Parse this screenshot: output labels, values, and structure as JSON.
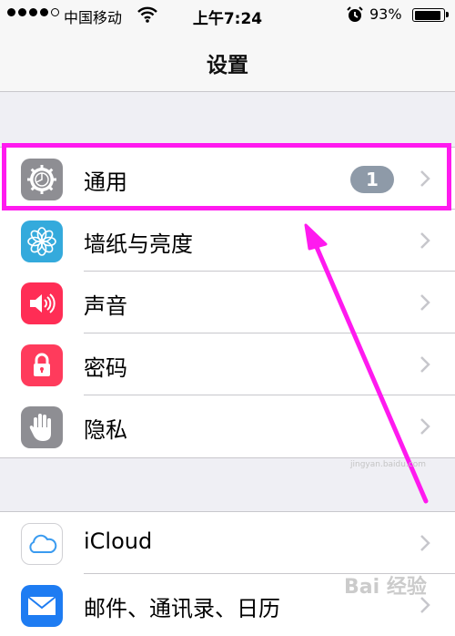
{
  "status_bar": {
    "signal_bars_filled": 4,
    "signal_bars_total": 5,
    "carrier": "中国移动",
    "time": "上午7:24",
    "battery_percent": "93%",
    "battery_level": 0.93
  },
  "nav": {
    "title": "设置"
  },
  "group1": {
    "items": [
      {
        "label": "通用",
        "icon": "gear-icon",
        "badge": "1"
      },
      {
        "label": "墙纸与亮度",
        "icon": "flower-icon"
      },
      {
        "label": "声音",
        "icon": "speaker-icon"
      },
      {
        "label": "密码",
        "icon": "lock-icon"
      },
      {
        "label": "隐私",
        "icon": "hand-icon"
      }
    ]
  },
  "group2": {
    "items": [
      {
        "label": "iCloud",
        "icon": "cloud-icon"
      },
      {
        "label": "邮件、通讯录、日历",
        "icon": "mail-icon"
      }
    ]
  },
  "colors": {
    "highlight": "#ff1aef",
    "general_icon": "#8e8e93",
    "wallpaper_icon": "#34aadc",
    "sound_icon": "#ff2d55",
    "passcode_icon": "#ff3b5c",
    "privacy_icon": "#8e8e93",
    "icloud_icon": "#ffffff",
    "mail_icon": "#1e7cf2"
  },
  "watermark": {
    "text": "Bai 经验",
    "sub": "jingyan.baidu.com"
  }
}
